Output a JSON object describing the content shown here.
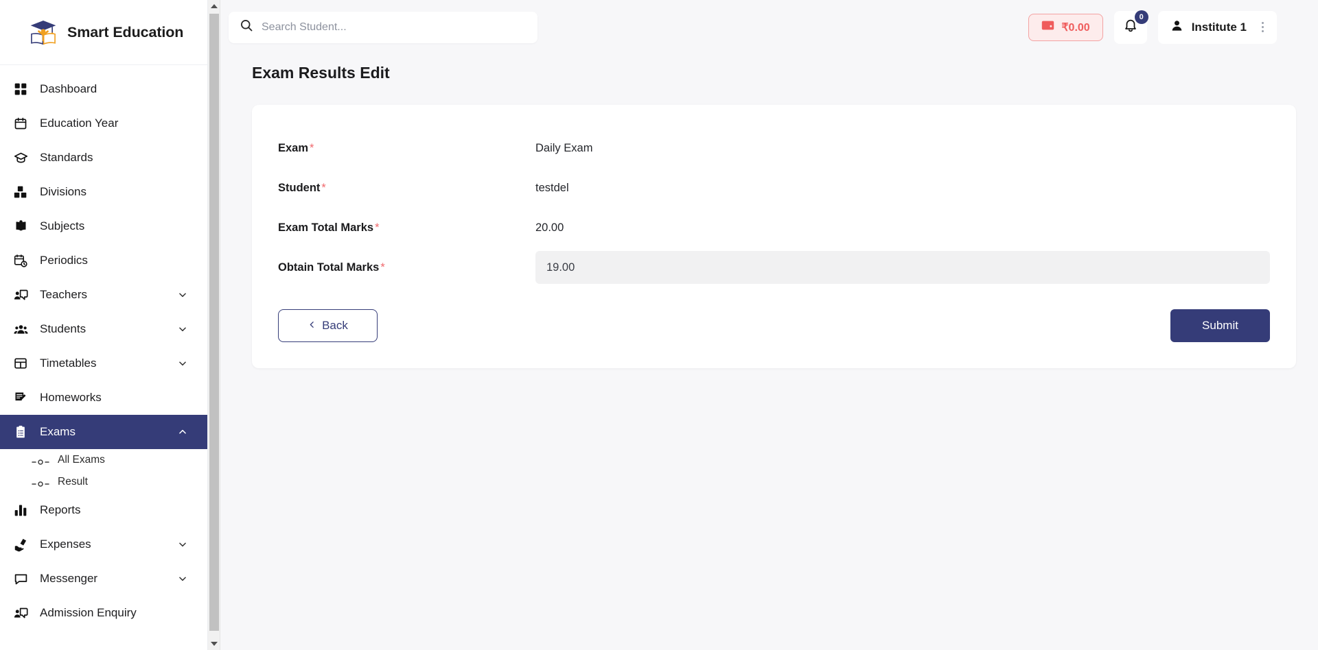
{
  "brand": {
    "title": "Smart Education",
    "logo_icon": "graduation-cap-logo"
  },
  "sidebar": {
    "items": [
      {
        "label": "Dashboard",
        "icon": "grid-icon",
        "expandable": false,
        "active": false
      },
      {
        "label": "Education Year",
        "icon": "calendar-icon",
        "expandable": false,
        "active": false
      },
      {
        "label": "Standards",
        "icon": "graduation-cap-icon",
        "expandable": false,
        "active": false
      },
      {
        "label": "Divisions",
        "icon": "blocks-icon",
        "expandable": false,
        "active": false
      },
      {
        "label": "Subjects",
        "icon": "book-open-icon",
        "expandable": false,
        "active": false
      },
      {
        "label": "Periodics",
        "icon": "calendar-clock-icon",
        "expandable": false,
        "active": false
      },
      {
        "label": "Teachers",
        "icon": "teacher-icon",
        "expandable": true,
        "active": false
      },
      {
        "label": "Students",
        "icon": "people-icon",
        "expandable": true,
        "active": false
      },
      {
        "label": "Timetables",
        "icon": "table-icon",
        "expandable": true,
        "active": false
      },
      {
        "label": "Homeworks",
        "icon": "notes-icon",
        "expandable": false,
        "active": false
      },
      {
        "label": "Exams",
        "icon": "clipboard-icon",
        "expandable": true,
        "active": true
      },
      {
        "label": "Reports",
        "icon": "bar-chart-icon",
        "expandable": false,
        "active": false
      },
      {
        "label": "Expenses",
        "icon": "money-hand-icon",
        "expandable": true,
        "active": false
      },
      {
        "label": "Messenger",
        "icon": "chat-icon",
        "expandable": true,
        "active": false
      },
      {
        "label": "Admission Enquiry",
        "icon": "teacher-icon",
        "expandable": false,
        "active": false
      }
    ],
    "exams_submenu": [
      {
        "label": "All Exams"
      },
      {
        "label": "Result"
      }
    ]
  },
  "topbar": {
    "search": {
      "placeholder": "Search Student...",
      "value": "",
      "icon": "search-icon"
    },
    "wallet": {
      "amount": "₹0.00",
      "icon": "wallet-icon"
    },
    "notifications": {
      "count": "0",
      "icon": "bell-icon"
    },
    "user": {
      "name": "Institute 1",
      "icon": "user-icon",
      "menu_icon": "kebab-menu-icon"
    }
  },
  "page": {
    "title": "Exam Results Edit",
    "fields": [
      {
        "label": "Exam",
        "required": "*",
        "value": "Daily Exam",
        "type": "text"
      },
      {
        "label": "Student",
        "required": "*",
        "value": "testdel",
        "type": "text"
      },
      {
        "label": "Exam Total Marks",
        "required": "*",
        "value": "20.00",
        "type": "text"
      },
      {
        "label": "Obtain Total Marks",
        "required": "*",
        "value": "19.00",
        "type": "input",
        "placeholder": ""
      }
    ],
    "buttons": {
      "back": "Back",
      "submit": "Submit"
    }
  },
  "colors": {
    "accent_navy": "#353c78",
    "danger_red": "#ef5c5c",
    "page_bg": "#f7f7f9",
    "card_bg": "#ffffff",
    "input_bg": "#f1f1f2",
    "required_star": "#f0696d"
  }
}
